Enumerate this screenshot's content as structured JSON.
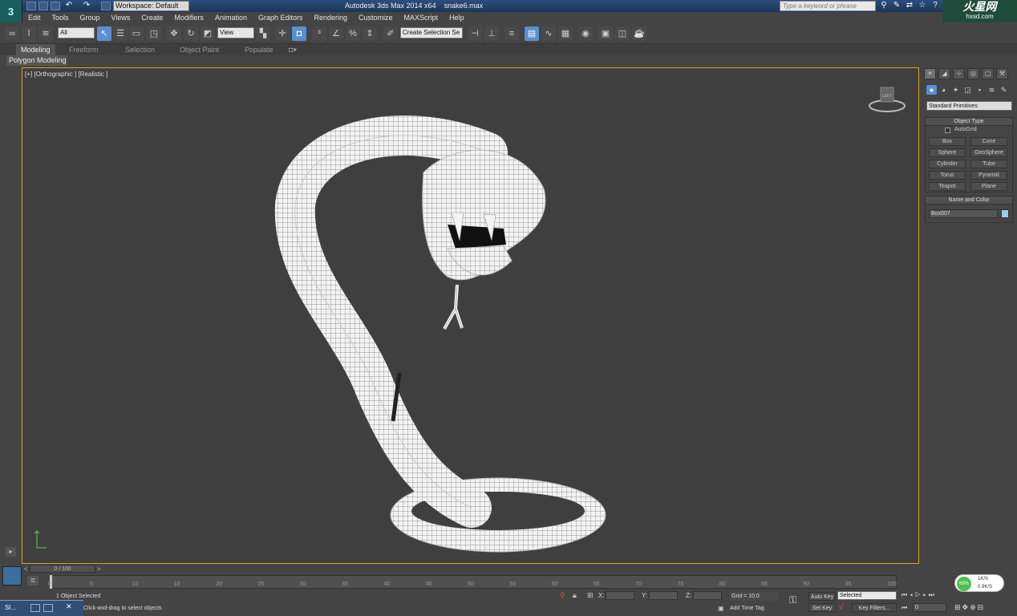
{
  "app": {
    "title": "Autodesk 3ds Max  2014 x64",
    "file": "snake6.max",
    "workspace": "Workspace: Default",
    "search_placeholder": "Type a keyword or phrase",
    "brand": "火星网",
    "brand_sub": "hxsd.com"
  },
  "menu": [
    "Edit",
    "Tools",
    "Group",
    "Views",
    "Create",
    "Modifiers",
    "Animation",
    "Graph Editors",
    "Rendering",
    "Customize",
    "MAXScript",
    "Help"
  ],
  "toolbar": {
    "selection_filter": "All",
    "ref_coord": "View",
    "named_selection": "Create Selection Se"
  },
  "ribbon": {
    "tabs": [
      "Modeling",
      "Freeform",
      "Selection",
      "Object Paint",
      "Populate"
    ],
    "active": "Modeling",
    "panel": "Polygon Modeling"
  },
  "viewport": {
    "label": "[+] [Orthographic ] [Realistic ]",
    "viewcube_label": "LEFT"
  },
  "command_panel": {
    "dropdown": "Standard Primitives",
    "object_type_title": "Object Type",
    "autogrid": "AutoGrid",
    "buttons": [
      "Box",
      "Cone",
      "Sphere",
      "GeoSphere",
      "Cylinder",
      "Tube",
      "Torus",
      "Pyramid",
      "Teapot",
      "Plane"
    ],
    "name_color_title": "Name and Color",
    "object_name": "Box007",
    "object_color": "#9ec8f0"
  },
  "timeline": {
    "slider": "0 / 100",
    "ticks": [
      "0",
      "5",
      "10",
      "15",
      "20",
      "25",
      "30",
      "35",
      "40",
      "45",
      "50",
      "55",
      "60",
      "65",
      "70",
      "75",
      "80",
      "85",
      "90",
      "95",
      "100"
    ]
  },
  "status": {
    "selected": "1 Object Selected",
    "prompt": "Click-and-drag to select objects",
    "x_label": "X:",
    "y_label": "Y:",
    "z_label": "Z:",
    "grid": "Grid = 10.0",
    "add_time_tag": "Add Time Tag",
    "auto_key": "Auto Key",
    "set_key": "Set Key",
    "key_mode": "Selected",
    "key_filters": "Key Filters...",
    "frame": "0"
  },
  "net": {
    "percent": "69%",
    "up": "1K/S",
    "down": "0.9K/S"
  },
  "taskbar": {
    "label": "Sl..."
  }
}
